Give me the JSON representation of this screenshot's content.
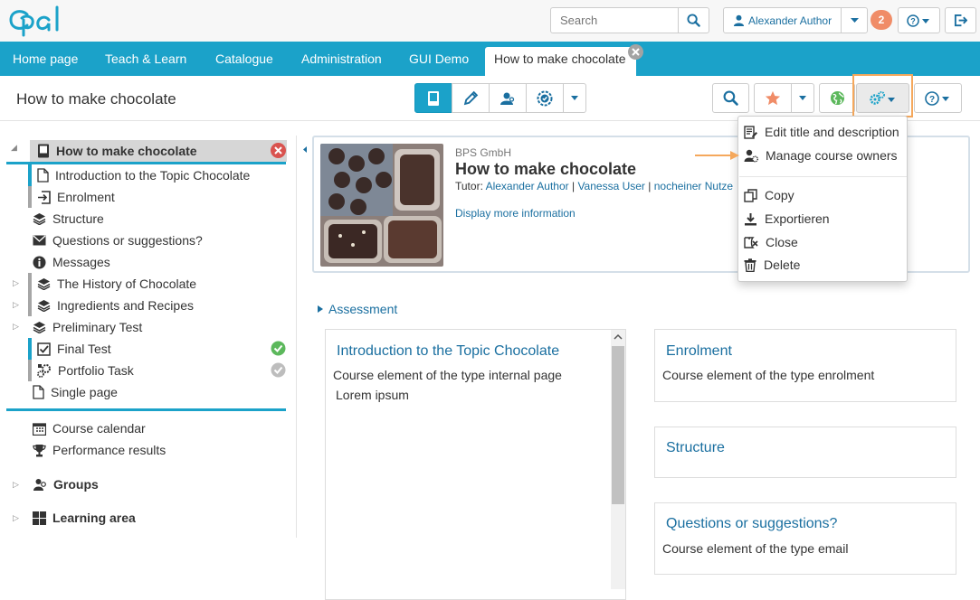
{
  "header": {
    "search_placeholder": "Search",
    "user_name": "Alexander Author",
    "notification_count": "2"
  },
  "nav": {
    "items": [
      "Home page",
      "Teach & Learn",
      "Catalogue",
      "Administration",
      "GUI Demo"
    ],
    "active_tab": "How to make chocolate"
  },
  "toolbar": {
    "title": "How to make chocolate"
  },
  "tree": {
    "root": "How to make chocolate",
    "items": [
      "Introduction to the Topic Chocolate",
      "Enrolment",
      "Structure",
      "Questions or suggestions?",
      "Messages",
      "The History of Chocolate",
      "Ingredients and Recipes",
      "Preliminary Test",
      "Final Test",
      "Portfolio Task",
      "Single page"
    ],
    "tools": [
      "Course calendar",
      "Performance results"
    ],
    "groups": "Groups",
    "learning_area": "Learning area"
  },
  "info": {
    "org": "BPS GmbH",
    "title": "How to make chocolate",
    "tutor_label": "Tutor:",
    "tutors": [
      "Alexander Author",
      "Vanessa User",
      "nocheiner Nutze"
    ],
    "more_link": "Display more information"
  },
  "assessment_label": "Assessment",
  "panels": {
    "intro_title": "Introduction to the Topic Chocolate",
    "intro_sub": "Course element of the type internal page",
    "intro_body": "Lorem ipsum",
    "enrol_title": "Enrolment",
    "enrol_sub": "Course element of the type enrolment",
    "struct_title": "Structure",
    "questions_title": "Questions or suggestions?",
    "questions_sub": "Course element of the type email"
  },
  "dropdown": {
    "edit": "Edit title and description",
    "owners": "Manage course owners",
    "copy": "Copy",
    "export": "Exportieren",
    "close": "Close",
    "delete": "Delete"
  },
  "colors": {
    "brand": "#1ba2c9",
    "link": "#1a6fa0",
    "highlight": "#f5a85c",
    "badge": "#f08c67",
    "close_red": "#d9534f",
    "check_green": "#5cb85c"
  }
}
